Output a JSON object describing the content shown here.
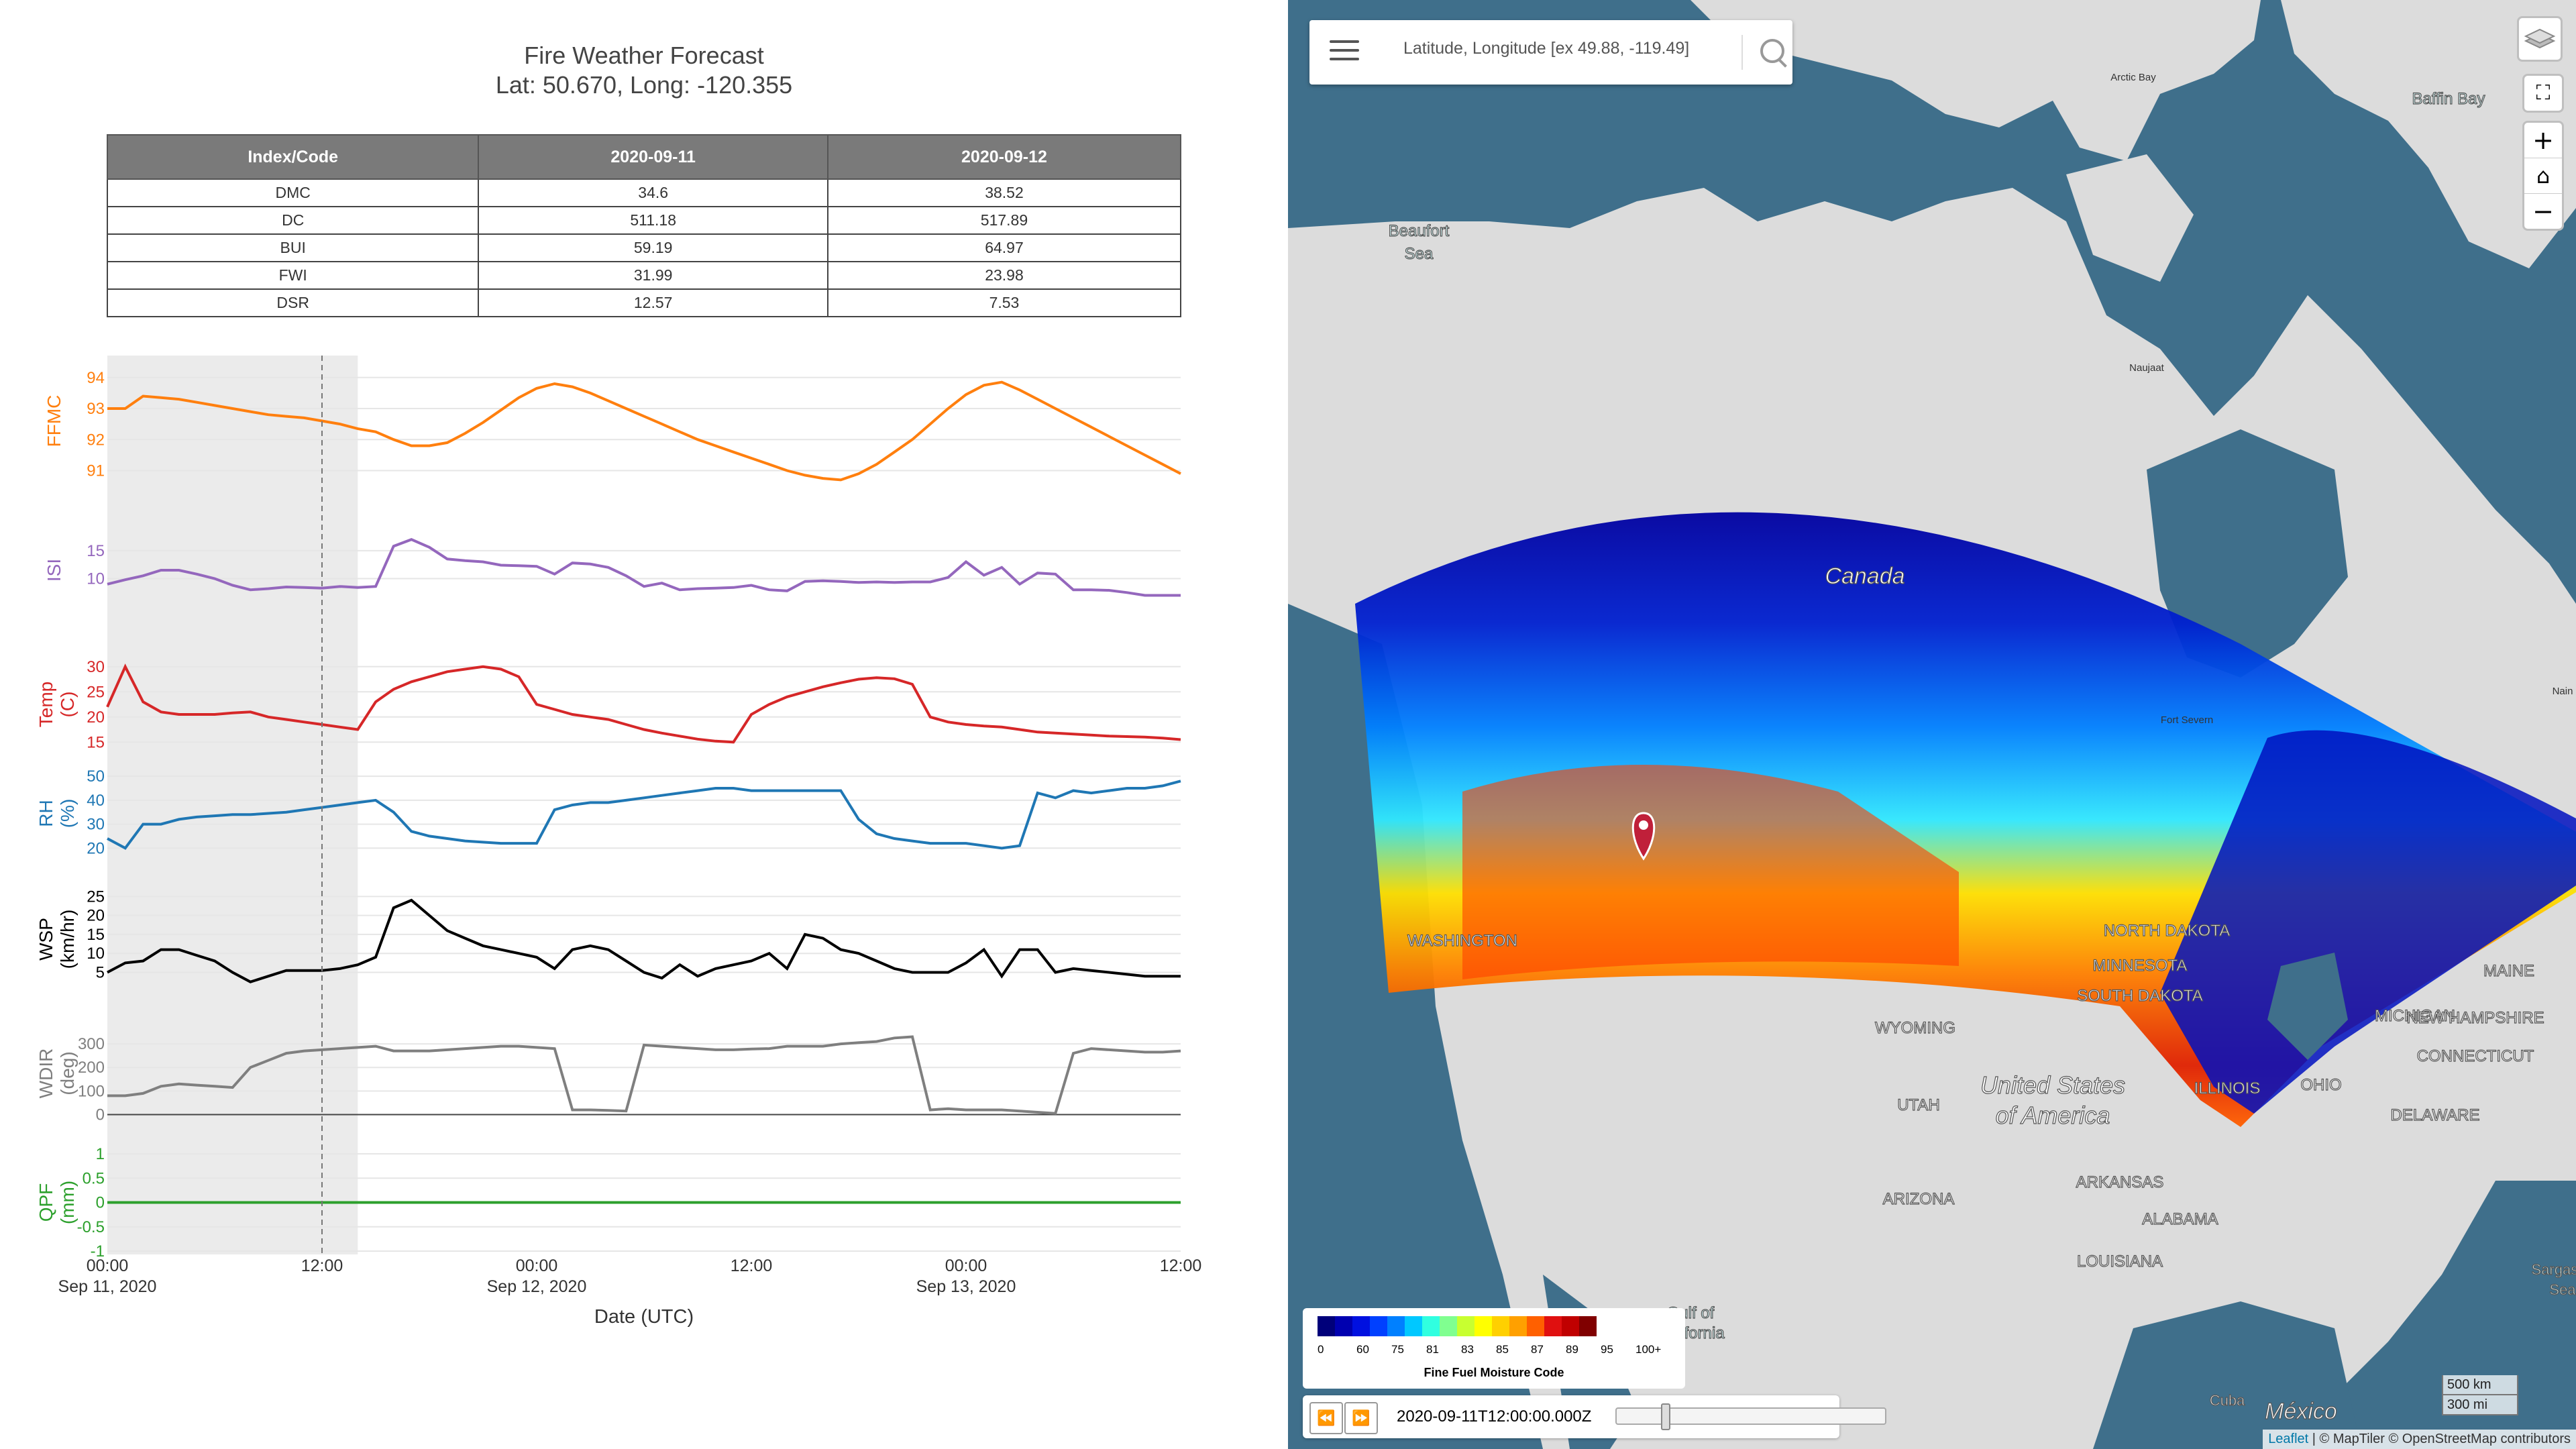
{
  "forecast": {
    "title": "Fire Weather Forecast",
    "subtitle": "Lat: 50.670, Long: -120.355",
    "table": {
      "headers": [
        "Index/Code",
        "2020-09-11",
        "2020-09-12"
      ],
      "rows": [
        [
          "DMC",
          "34.6",
          "38.52"
        ],
        [
          "DC",
          "511.18",
          "517.89"
        ],
        [
          "BUI",
          "59.19",
          "64.97"
        ],
        [
          "FWI",
          "31.99",
          "23.98"
        ],
        [
          "DSR",
          "12.57",
          "7.53"
        ]
      ]
    }
  },
  "chart_data": {
    "type": "line",
    "xlabel": "Date (UTC)",
    "x_ticks": [
      [
        "00:00",
        "Sep 11, 2020"
      ],
      [
        "12:00",
        ""
      ],
      [
        "00:00",
        "Sep 12, 2020"
      ],
      [
        "12:00",
        ""
      ],
      [
        "00:00",
        "Sep 13, 2020"
      ],
      [
        "12:00",
        ""
      ]
    ],
    "x_hours": [
      0,
      1,
      2,
      3,
      4,
      5,
      6,
      7,
      8,
      9,
      10,
      11,
      12,
      13,
      14,
      15,
      16,
      17,
      18,
      19,
      20,
      21,
      22,
      23,
      24,
      25,
      26,
      27,
      28,
      29,
      30,
      31,
      32,
      33,
      34,
      35,
      36,
      37,
      38,
      39,
      40,
      41,
      42,
      43,
      44,
      45,
      46,
      47,
      48,
      49,
      50,
      51,
      52,
      53,
      54,
      55,
      56,
      57,
      58,
      59,
      60
    ],
    "shaded_until_hour": 14,
    "now_marker_hour": 12,
    "panels": [
      {
        "name": "FFMC",
        "ylabel": "FFMC",
        "color": "#ff7f0e",
        "yticks": [
          91,
          92,
          93,
          94
        ],
        "ylim": [
          90.6,
          94.6
        ],
        "values": [
          93.0,
          93.0,
          93.4,
          93.35,
          93.3,
          93.2,
          93.1,
          93.0,
          92.9,
          92.8,
          92.75,
          92.7,
          92.6,
          92.5,
          92.35,
          92.25,
          92.0,
          91.8,
          91.8,
          91.9,
          92.2,
          92.55,
          92.95,
          93.35,
          93.65,
          93.8,
          93.7,
          93.5,
          93.25,
          93.0,
          92.75,
          92.5,
          92.25,
          92.0,
          91.8,
          91.6,
          91.4,
          91.2,
          91.0,
          90.85,
          90.75,
          90.7,
          90.9,
          91.2,
          91.6,
          92.0,
          92.5,
          93.0,
          93.45,
          93.75,
          93.85,
          93.6,
          93.3,
          93.0,
          92.7,
          92.4,
          92.1,
          91.8,
          91.5,
          91.2,
          90.9
        ]
      },
      {
        "name": "ISI",
        "ylabel": "ISI",
        "color": "#9467bd",
        "yticks": [
          10,
          15
        ],
        "ylim": [
          5.5,
          17.5
        ],
        "values": [
          9.0,
          9.8,
          10.5,
          11.5,
          11.5,
          10.8,
          10.0,
          8.8,
          8.0,
          8.2,
          8.5,
          8.4,
          8.3,
          8.6,
          8.4,
          8.6,
          15.8,
          17.0,
          15.6,
          13.5,
          13.2,
          13.0,
          12.4,
          12.3,
          12.2,
          10.8,
          12.8,
          12.6,
          12.0,
          10.5,
          8.6,
          9.2,
          8.0,
          8.2,
          8.3,
          8.4,
          8.8,
          8.0,
          7.8,
          9.5,
          9.6,
          9.5,
          9.3,
          9.4,
          9.3,
          9.4,
          9.4,
          10.2,
          13.0,
          10.6,
          12.0,
          9.0,
          11.0,
          10.8,
          8.0,
          8.0,
          7.9,
          7.5,
          7.0,
          7.0,
          7.0
        ]
      },
      {
        "name": "Temp",
        "ylabel": "Temp (C)",
        "color": "#d62728",
        "yticks": [
          15,
          20,
          25,
          30
        ],
        "ylim": [
          12.5,
          32.5
        ],
        "values": [
          22,
          30,
          23,
          21,
          20.5,
          20.5,
          20.5,
          20.8,
          21,
          20,
          19.5,
          19,
          18.5,
          18,
          17.5,
          23,
          25.5,
          27,
          28,
          29,
          29.5,
          30,
          29.5,
          28,
          22.5,
          21.5,
          20.5,
          20,
          19.5,
          18.5,
          17.5,
          16.8,
          16.2,
          15.6,
          15.2,
          15,
          20.5,
          22.5,
          24,
          25,
          26,
          26.8,
          27.5,
          27.8,
          27.6,
          26.5,
          20,
          19,
          18.5,
          18.2,
          18,
          17.5,
          17,
          16.8,
          16.6,
          16.4,
          16.2,
          16.1,
          16,
          15.8,
          15.5
        ]
      },
      {
        "name": "RH",
        "ylabel": "RH (%)",
        "color": "#1f77b4",
        "yticks": [
          20,
          30,
          40,
          50
        ],
        "ylim": [
          17,
          52
        ],
        "values": [
          24,
          20,
          30,
          30,
          32,
          33,
          33.5,
          34,
          34,
          34.5,
          35,
          36,
          37,
          38,
          39,
          40,
          35,
          27,
          25,
          24,
          23,
          22.5,
          22,
          22,
          22,
          36,
          38,
          39,
          39,
          40,
          41,
          42,
          43,
          44,
          45,
          45,
          44,
          44,
          44,
          44,
          44,
          44,
          32,
          26,
          24,
          23,
          22,
          22,
          22,
          21,
          20,
          21,
          43,
          41,
          44,
          43,
          44,
          45,
          45,
          46,
          48
        ]
      },
      {
        "name": "WSP",
        "ylabel": "WSP (km/hr)",
        "color": "#000000",
        "yticks": [
          5,
          10,
          15,
          20,
          25
        ],
        "ylim": [
          0.5,
          27
        ],
        "values": [
          5,
          7.5,
          8,
          11,
          11,
          9.5,
          8,
          5,
          2.5,
          4,
          5.5,
          5.5,
          5.5,
          6,
          7,
          9,
          22,
          24,
          20,
          16,
          14,
          12,
          11,
          10,
          9,
          6,
          11,
          12,
          11,
          8,
          5,
          3.5,
          7,
          4,
          6,
          7,
          8,
          10,
          6,
          15,
          14,
          11,
          10,
          8,
          6,
          5,
          5,
          5,
          7.5,
          11,
          4,
          11,
          11,
          5,
          6,
          5.5,
          5,
          4.5,
          4,
          4,
          4
        ]
      },
      {
        "name": "WDIR",
        "ylabel": "WDIR (deg)",
        "color": "#7f7f7f",
        "yticks": [
          0,
          100,
          200,
          300
        ],
        "ylim": [
          -10,
          360
        ],
        "values": [
          80,
          80,
          90,
          120,
          130,
          125,
          120,
          115,
          200,
          230,
          260,
          270,
          275,
          280,
          285,
          290,
          270,
          270,
          270,
          275,
          280,
          285,
          290,
          290,
          285,
          280,
          20,
          20,
          18,
          15,
          295,
          290,
          285,
          280,
          275,
          275,
          278,
          280,
          290,
          290,
          290,
          300,
          305,
          310,
          325,
          330,
          20,
          25,
          20,
          20,
          20,
          15,
          10,
          5,
          260,
          280,
          275,
          270,
          265,
          265,
          270
        ]
      },
      {
        "name": "QPF",
        "ylabel": "QPF (mm)",
        "color": "#2ca02c",
        "yticks": [
          -1,
          -0.5,
          0,
          0.5,
          1
        ],
        "ylim": [
          -1,
          1
        ],
        "values": [
          0,
          0,
          0,
          0,
          0,
          0,
          0,
          0,
          0,
          0,
          0,
          0,
          0,
          0,
          0,
          0,
          0,
          0,
          0,
          0,
          0,
          0,
          0,
          0,
          0,
          0,
          0,
          0,
          0,
          0,
          0,
          0,
          0,
          0,
          0,
          0,
          0,
          0,
          0,
          0,
          0,
          0,
          0,
          0,
          0,
          0,
          0,
          0,
          0,
          0,
          0,
          0,
          0,
          0,
          0,
          0,
          0,
          0,
          0,
          0,
          0
        ]
      }
    ]
  },
  "map": {
    "search_placeholder": "Latitude, Longitude [ex 49.88, -119.49]",
    "zoom_in": "+",
    "zoom_out": "−",
    "home_icon": "home-icon",
    "legend": {
      "colors": [
        "#00007a",
        "#0000b0",
        "#0010e0",
        "#0040ff",
        "#0080ff",
        "#00c8ff",
        "#30ffe0",
        "#80ff90",
        "#c8ff30",
        "#ffff00",
        "#ffd000",
        "#ffa000",
        "#ff6000",
        "#e01010",
        "#c00000",
        "#800000"
      ],
      "ticks": [
        "0",
        "60",
        "75",
        "81",
        "83",
        "85",
        "87",
        "89",
        "95",
        "100+"
      ],
      "title": "Fine Fuel Moisture Code"
    },
    "timestamp": "2020-09-11T12:00:00.000Z",
    "time_slider_fraction": 0.05,
    "scale": [
      "500 km",
      "300 mi"
    ],
    "attribution": {
      "leaflet": "Leaflet",
      "rest": " | © MapTiler © OpenStreetMap contributors"
    },
    "labels": [
      "Canada",
      "United States",
      "of America",
      "México",
      "WASHINGTON",
      "NORTH DAKOTA",
      "SOUTH DAKOTA",
      "MINNESOTA",
      "WYOMING",
      "UTAH",
      "ARIZONA",
      "ILLINOIS",
      "OHIO",
      "MICHIGAN",
      "NEW HAMPSHIRE",
      "CONNECTICUT",
      "DELAWARE",
      "MAINE",
      "ARKANSAS",
      "ALABAMA",
      "LOUISIANA",
      "Beaufort",
      "Sea",
      "Baffin Bay",
      "Gulf of",
      "California",
      "Cuba",
      "Sargasso",
      "Sea",
      "Arctic Bay",
      "Naujaat",
      "Fort Severn",
      "Nain"
    ]
  }
}
